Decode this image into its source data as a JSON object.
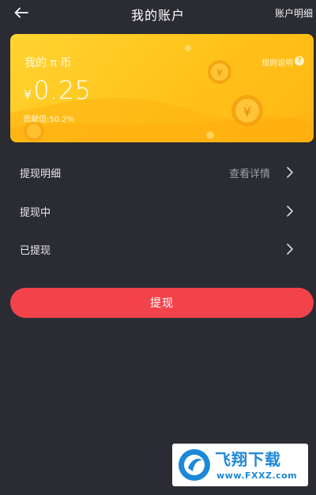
{
  "header": {
    "title": "我的账户",
    "right_link": "账户明细"
  },
  "card": {
    "coin_label": "我的 π 币",
    "rules_label": "规则说明",
    "rules_icon_glyph": "?",
    "currency_symbol": "¥",
    "balance": "0.25",
    "contribution": "贡献值:50.2%",
    "accent_colors": [
      "#ffd431",
      "#ffb614"
    ]
  },
  "list": [
    {
      "label": "提现明细",
      "value": "查看详情"
    },
    {
      "label": "提现中",
      "value": ""
    },
    {
      "label": "已提现",
      "value": ""
    }
  ],
  "withdraw_button": {
    "label": "提现",
    "color": "#f2434b"
  },
  "watermark": {
    "brand": "飞翔下载",
    "url": "www.FXXZ.com"
  },
  "theme": {
    "background": "#2b2c33"
  }
}
